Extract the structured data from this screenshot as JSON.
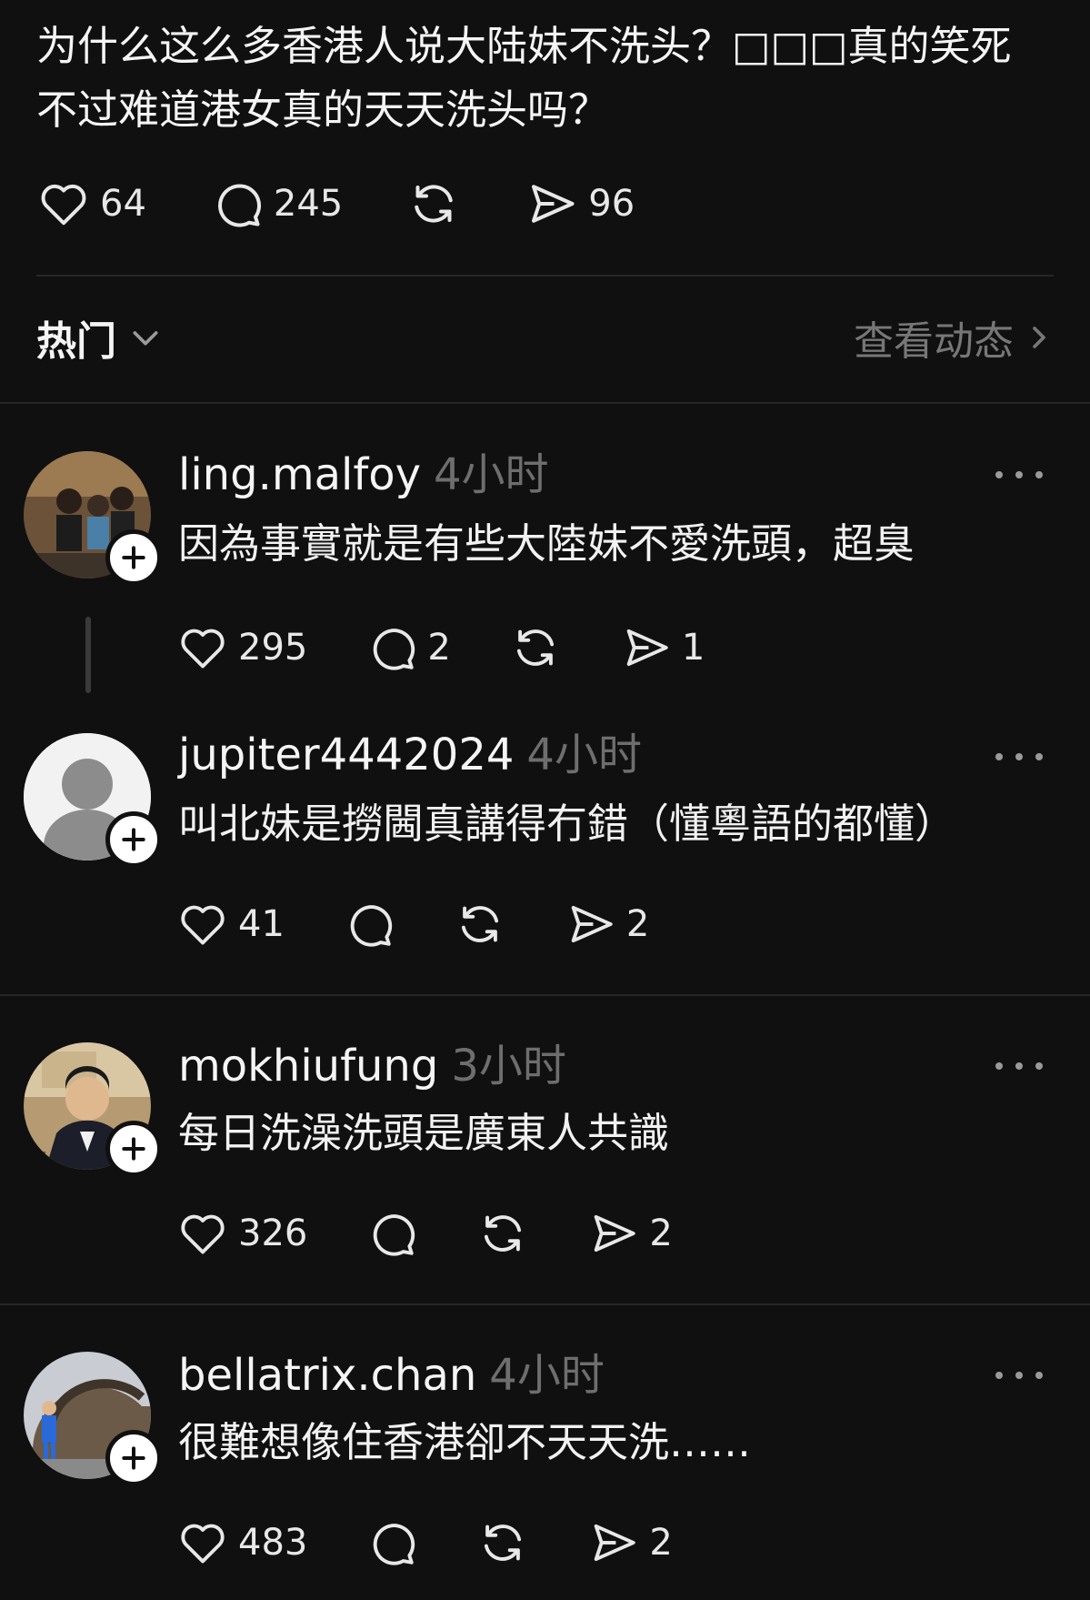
{
  "post": {
    "text": "为什么这么多香港人说大陆妹不洗头？□□□真的笑死 不过难道港女真的天天洗头吗？",
    "likes": "64",
    "comments": "245",
    "shares": "96"
  },
  "sort": {
    "label": "热门",
    "view_activity": "查看动态"
  },
  "comments": [
    {
      "username": "ling.malfoy",
      "time": "4小时",
      "text": "因為事實就是有些大陸妹不愛洗頭，超臭",
      "likes": "295",
      "replies": "2",
      "shares": "1"
    },
    {
      "username": "jupiter4442024",
      "time": "4小时",
      "text": "叫北妹是撈閪真講得冇錯（￼懂粵語的都懂）",
      "likes": "41",
      "replies": "",
      "shares": "2"
    },
    {
      "username": "mokhiufung",
      "time": "3小时",
      "text": "每日洗澡洗頭是廣東人共識",
      "likes": "326",
      "replies": "",
      "shares": "2"
    },
    {
      "username": "bellatrix.chan",
      "time": "4小时",
      "text": "很難想像住香港卻不天天洗……",
      "likes": "483",
      "replies": "",
      "shares": "2"
    }
  ]
}
